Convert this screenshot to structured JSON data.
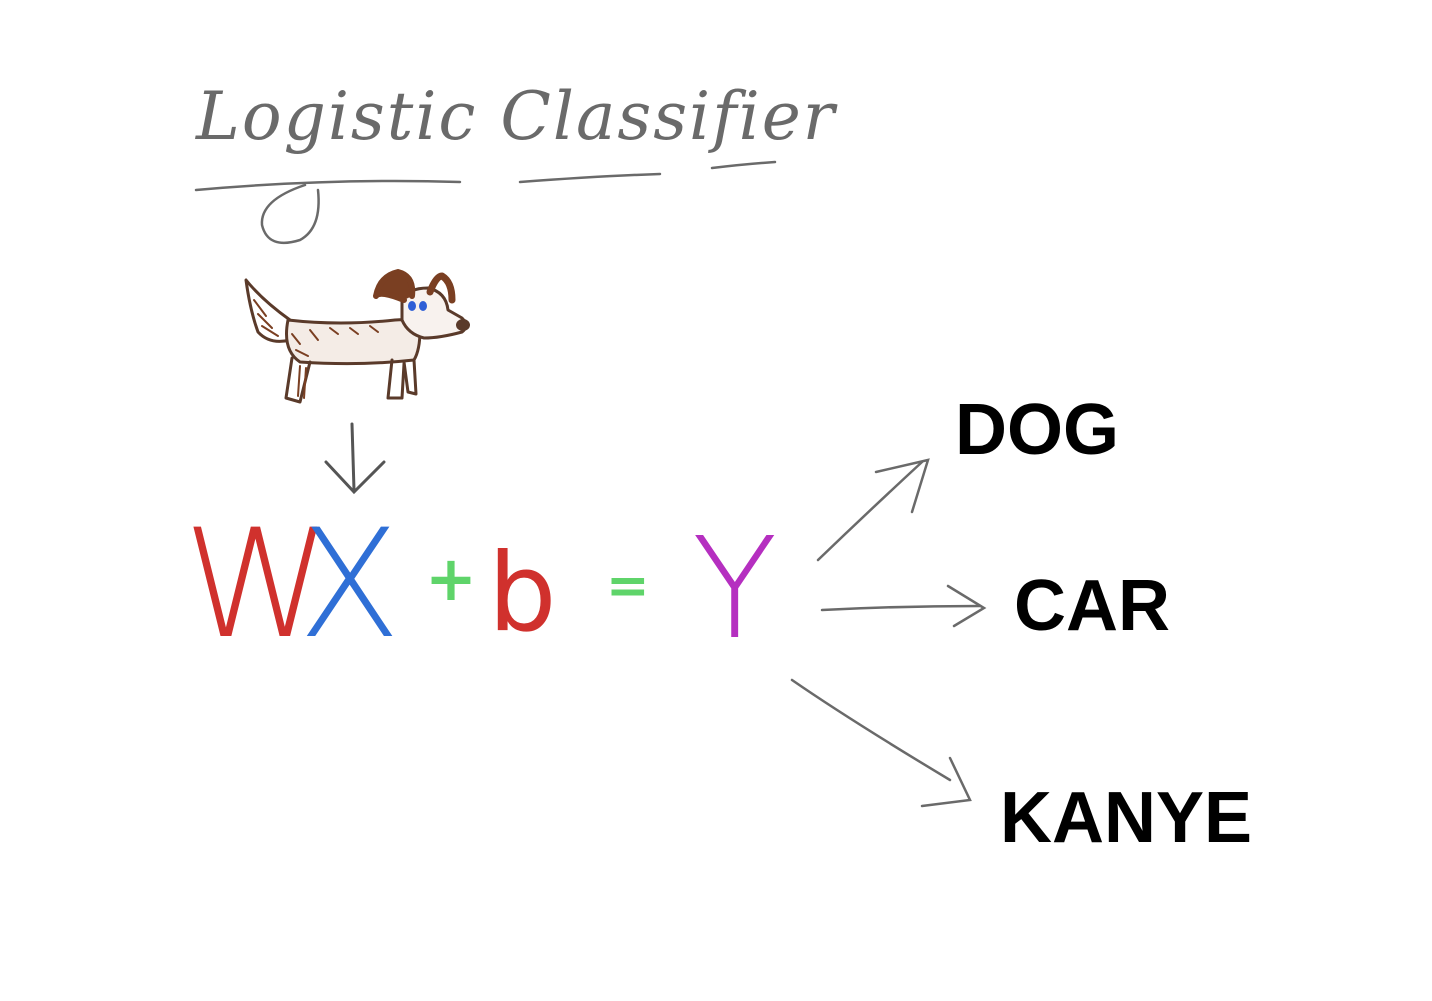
{
  "title": "Logistic Classifier",
  "equation": {
    "w": "W",
    "x": "X",
    "plus": "+",
    "b": "b",
    "equals": "=",
    "y": "Y"
  },
  "outputs": [
    "DOG",
    "CAR",
    "KANYE"
  ],
  "colors": {
    "title": "#6a6a6a",
    "w": "#d0312d",
    "x": "#2f6fd6",
    "plus": "#5fd46a",
    "b": "#d0312d",
    "equals": "#5fd46a",
    "y": "#b52fc0",
    "arrows": "#6a6a6a",
    "dog_outline": "#5a3a2a",
    "dog_ears": "#7a3f22",
    "dog_eyes": "#2f5fd6"
  },
  "icons": [
    "dog-drawing-icon",
    "down-arrow-icon"
  ]
}
